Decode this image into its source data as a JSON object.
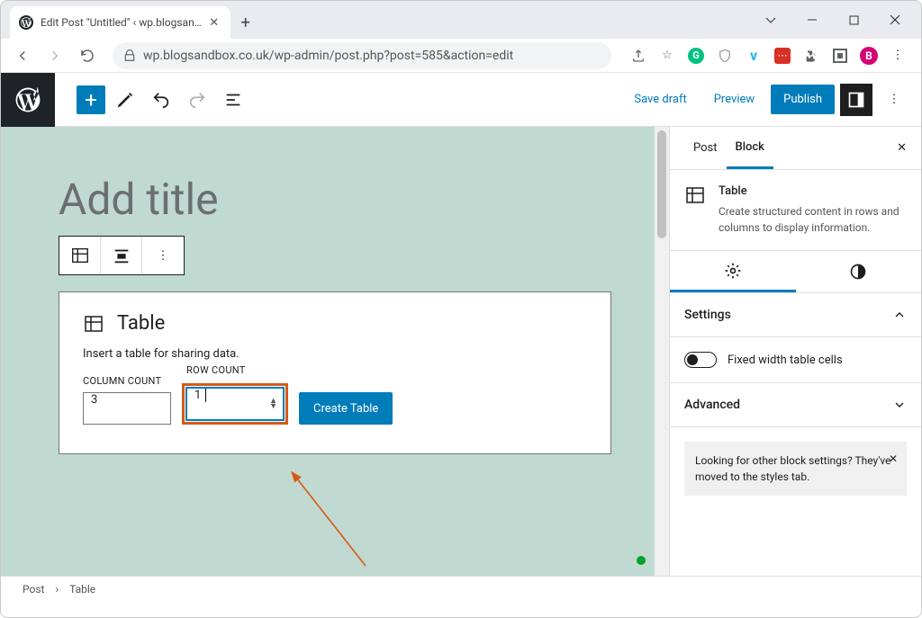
{
  "browser": {
    "tab_title": "Edit Post \"Untitled\" ‹ wp.blogsan…",
    "url": "wp.blogsandbox.co.uk/wp-admin/post.php?post=585&action=edit",
    "profile_letter": "B"
  },
  "toolbar": {
    "save_draft": "Save draft",
    "preview": "Preview",
    "publish": "Publish"
  },
  "editor": {
    "title_placeholder": "Add title",
    "table_block": {
      "heading": "Table",
      "description": "Insert a table for sharing data.",
      "column_label": "COLUMN COUNT",
      "column_value": "3",
      "row_label": "ROW COUNT",
      "row_value": "1",
      "create_button": "Create Table"
    }
  },
  "sidebar": {
    "tab_post": "Post",
    "tab_block": "Block",
    "block_name": "Table",
    "block_desc": "Create structured content in rows and columns to display information.",
    "settings_label": "Settings",
    "fixed_width_label": "Fixed width table cells",
    "advanced_label": "Advanced",
    "hint_text": "Looking for other block settings? They've moved to the styles tab."
  },
  "breadcrumb": {
    "root": "Post",
    "current": "Table"
  }
}
